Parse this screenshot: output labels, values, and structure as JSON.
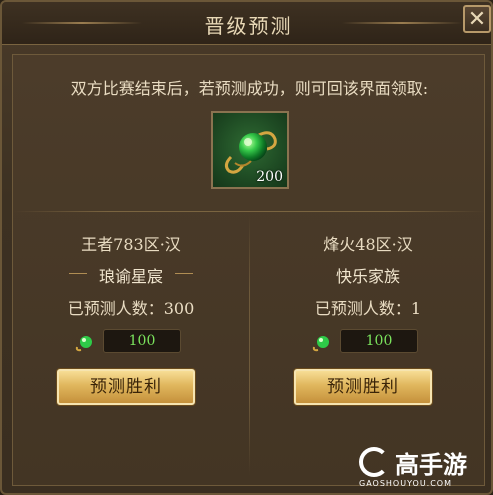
{
  "dialog": {
    "title": "晋级预测",
    "close_icon": "close-icon"
  },
  "instruction": "双方比赛结束后，若预测成功，则可回该界面领取:",
  "reward": {
    "icon": "green-orb-icon",
    "quantity": "200"
  },
  "left": {
    "server": "王者783区·汉",
    "team": "琅谕星宸",
    "count_label": "已预测人数：300",
    "bet_value": "100",
    "button_label": "预测胜利"
  },
  "right": {
    "server": "烽火48区·汉",
    "team": "快乐家族",
    "count_label": "已预测人数：1",
    "bet_value": "100",
    "button_label": "预测胜利"
  },
  "watermark": {
    "text": "高手游",
    "sub": "GAOSHOUYOU.COM"
  },
  "colors": {
    "accent_gold": "#e0b65d",
    "bet_green": "#7be35d",
    "panel_brown": "#433524"
  }
}
